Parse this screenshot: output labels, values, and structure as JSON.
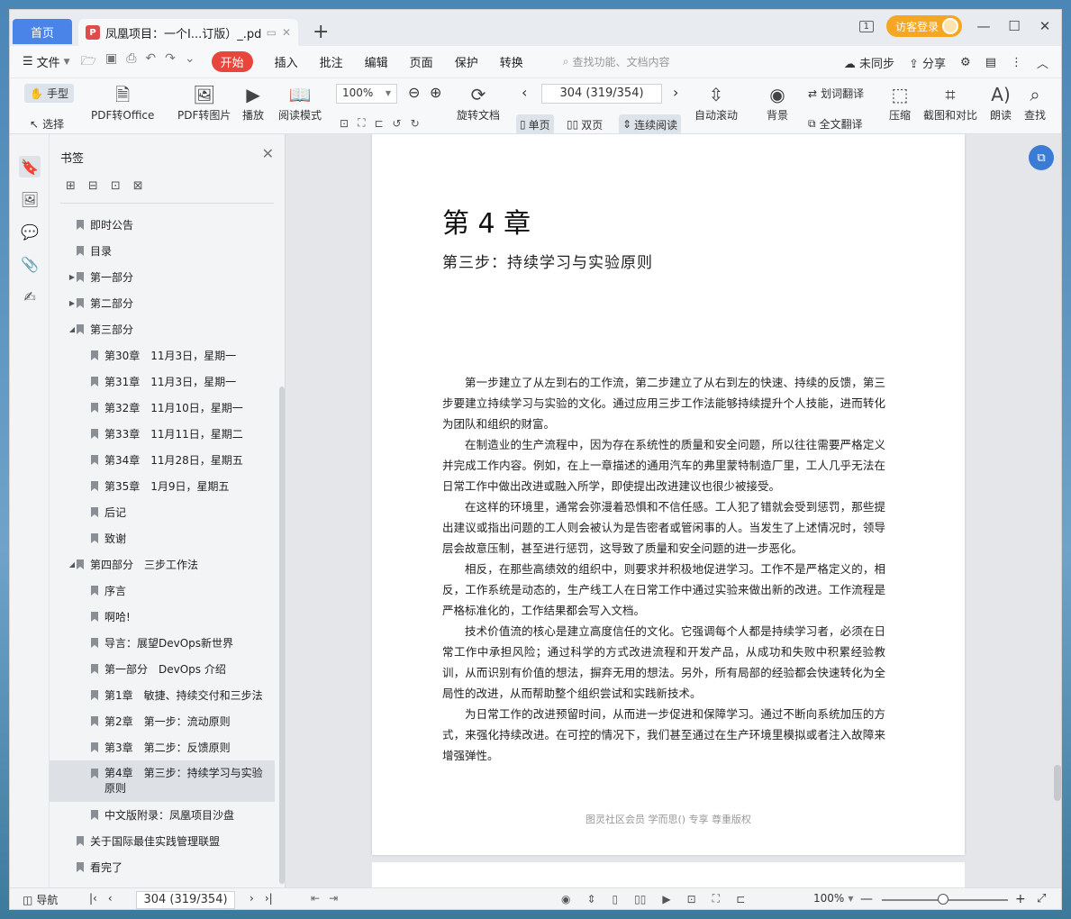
{
  "titlebar": {
    "home_tab": "首页",
    "doc_tab": "凤凰项目：一个I...订版）_.pdf",
    "pdf_badge": "P",
    "add_tab": "+",
    "window_badge": "1",
    "guest_login": "访客登录"
  },
  "menubar": {
    "file": "文件",
    "items": [
      "开始",
      "插入",
      "批注",
      "编辑",
      "页面",
      "保护",
      "转换"
    ],
    "search_placeholder": "查找功能、文档内容",
    "unsynced": "未同步",
    "share": "分享"
  },
  "toolbar": {
    "hand": "手型",
    "select": "选择",
    "pdf_to_office": "PDF转Office",
    "pdf_to_image": "PDF转图片",
    "play": "播放",
    "read_mode": "阅读模式",
    "zoom": "100%",
    "rotate_doc": "旋转文档",
    "page_indicator": "304 (319/354)",
    "single_page": "单页",
    "double_page": "双页",
    "continuous": "连续阅读",
    "auto_scroll": "自动滚动",
    "background": "背景",
    "word_translate": "划词翻译",
    "full_translate": "全文翻译",
    "compress": "压缩",
    "screenshot_compare": "截图和对比",
    "read_aloud": "朗读",
    "find": "查找"
  },
  "bookmarks": {
    "title": "书签",
    "items": [
      {
        "label": "即时公告",
        "level": 0,
        "arrow": ""
      },
      {
        "label": "目录",
        "level": 0,
        "arrow": ""
      },
      {
        "label": "第一部分",
        "level": 0,
        "arrow": "▶"
      },
      {
        "label": "第二部分",
        "level": 0,
        "arrow": "▶"
      },
      {
        "label": "第三部分",
        "level": 0,
        "arrow": "◢"
      },
      {
        "label": "第30章　11月3日，星期一",
        "level": 1,
        "arrow": ""
      },
      {
        "label": "第31章　11月3日，星期一",
        "level": 1,
        "arrow": ""
      },
      {
        "label": "第32章　11月10日，星期一",
        "level": 1,
        "arrow": ""
      },
      {
        "label": "第33章　11月11日，星期二",
        "level": 1,
        "arrow": ""
      },
      {
        "label": "第34章　11月28日，星期五",
        "level": 1,
        "arrow": ""
      },
      {
        "label": "第35章　1月9日，星期五",
        "level": 1,
        "arrow": ""
      },
      {
        "label": "后记",
        "level": 1,
        "arrow": ""
      },
      {
        "label": "致谢",
        "level": 1,
        "arrow": ""
      },
      {
        "label": "第四部分　三步工作法",
        "level": 0,
        "arrow": "◢"
      },
      {
        "label": "序言",
        "level": 1,
        "arrow": ""
      },
      {
        "label": "啊哈!",
        "level": 1,
        "arrow": ""
      },
      {
        "label": "导言：展望DevOps新世界",
        "level": 1,
        "arrow": ""
      },
      {
        "label": "第一部分　DevOps 介绍",
        "level": 1,
        "arrow": ""
      },
      {
        "label": "第1章　敏捷、持续交付和三步法",
        "level": 1,
        "arrow": ""
      },
      {
        "label": "第2章　第一步：流动原则",
        "level": 1,
        "arrow": ""
      },
      {
        "label": "第3章　第二步：反馈原则",
        "level": 1,
        "arrow": ""
      },
      {
        "label": "第4章　第三步：持续学习与实验原则",
        "level": 1,
        "arrow": "",
        "selected": true
      },
      {
        "label": "中文版附录：凤凰项目沙盘",
        "level": 1,
        "arrow": ""
      },
      {
        "label": "关于国际最佳实践管理联盟",
        "level": 0,
        "arrow": ""
      },
      {
        "label": "看完了",
        "level": 0,
        "arrow": ""
      }
    ]
  },
  "document": {
    "chapter_title": "第 4 章",
    "chapter_subtitle": "第三步：持续学习与实验原则",
    "paragraphs": [
      "第一步建立了从左到右的工作流，第二步建立了从右到左的快速、持续的反馈，第三步要建立持续学习与实验的文化。通过应用三步工作法能够持续提升个人技能，进而转化为团队和组织的财富。",
      "在制造业的生产流程中，因为存在系统性的质量和安全问题，所以往往需要严格定义并完成工作内容。例如，在上一章描述的通用汽车的弗里蒙特制造厂里，工人几乎无法在日常工作中做出改进或融入所学，即使提出改进建议也很少被接受。",
      "在这样的环境里，通常会弥漫着恐惧和不信任感。工人犯了错就会受到惩罚，那些提出建议或指出问题的工人则会被认为是告密者或管闲事的人。当发生了上述情况时，领导层会故意压制，甚至进行惩罚，这导致了质量和安全问题的进一步恶化。",
      "相反，在那些高绩效的组织中，则要求并积极地促进学习。工作不是严格定义的，相反，工作系统是动态的，生产线工人在日常工作中通过实验来做出新的改进。工作流程是严格标准化的，工作结果都会写入文档。",
      "技术价值流的核心是建立高度信任的文化。它强调每个人都是持续学习者，必须在日常工作中承担风险；通过科学的方式改进流程和开发产品，从成功和失败中积累经验教训，从而识别有价值的想法，摒弃无用的想法。另外，所有局部的经验都会快速转化为全局性的改进，从而帮助整个组织尝试和实践新技术。",
      "为日常工作的改进预留时间，从而进一步促进和保障学习。通过不断向系统加压的方式，来强化持续改进。在可控的情况下，我们甚至通过在生产环境里模拟或者注入故障来增强弹性。"
    ],
    "watermark": "图灵社区会员 学而思() 专享 尊重版权"
  },
  "statusbar": {
    "nav": "导航",
    "page_indicator": "304 (319/354)",
    "zoom": "100%"
  },
  "colors": {
    "home_tab": "#4a84e8",
    "active_menu": "#e8453c",
    "guest_button": "#f5a623",
    "float_button": "#3a7bd5"
  }
}
